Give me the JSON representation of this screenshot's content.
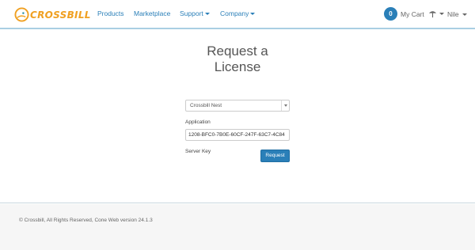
{
  "header": {
    "logo_text": "CROSSBILL",
    "nav": [
      {
        "label": "Products"
      },
      {
        "label": "Marketplace"
      },
      {
        "label": "Support"
      },
      {
        "label": "Company"
      }
    ],
    "cart_count": "0",
    "cart_label": "My Cart",
    "user_label": "Nile"
  },
  "form": {
    "title_line1": "Request a",
    "title_line2": "License",
    "application_label": "Application",
    "application_value": "Crossbill Nest",
    "server_key_label": "Server Key",
    "server_key_value": "1208-BFC0-7B0E-60CF-247F-63C7-4C84",
    "submit_label": "Request"
  },
  "footer": {
    "text": "© Crossbill, All Rights Reserved, Cone Web version 24.1.3"
  },
  "colors": {
    "accent": "#2a7fb8",
    "logo_orange": "#f0a021",
    "logo_teal": "#2c8fa6"
  }
}
